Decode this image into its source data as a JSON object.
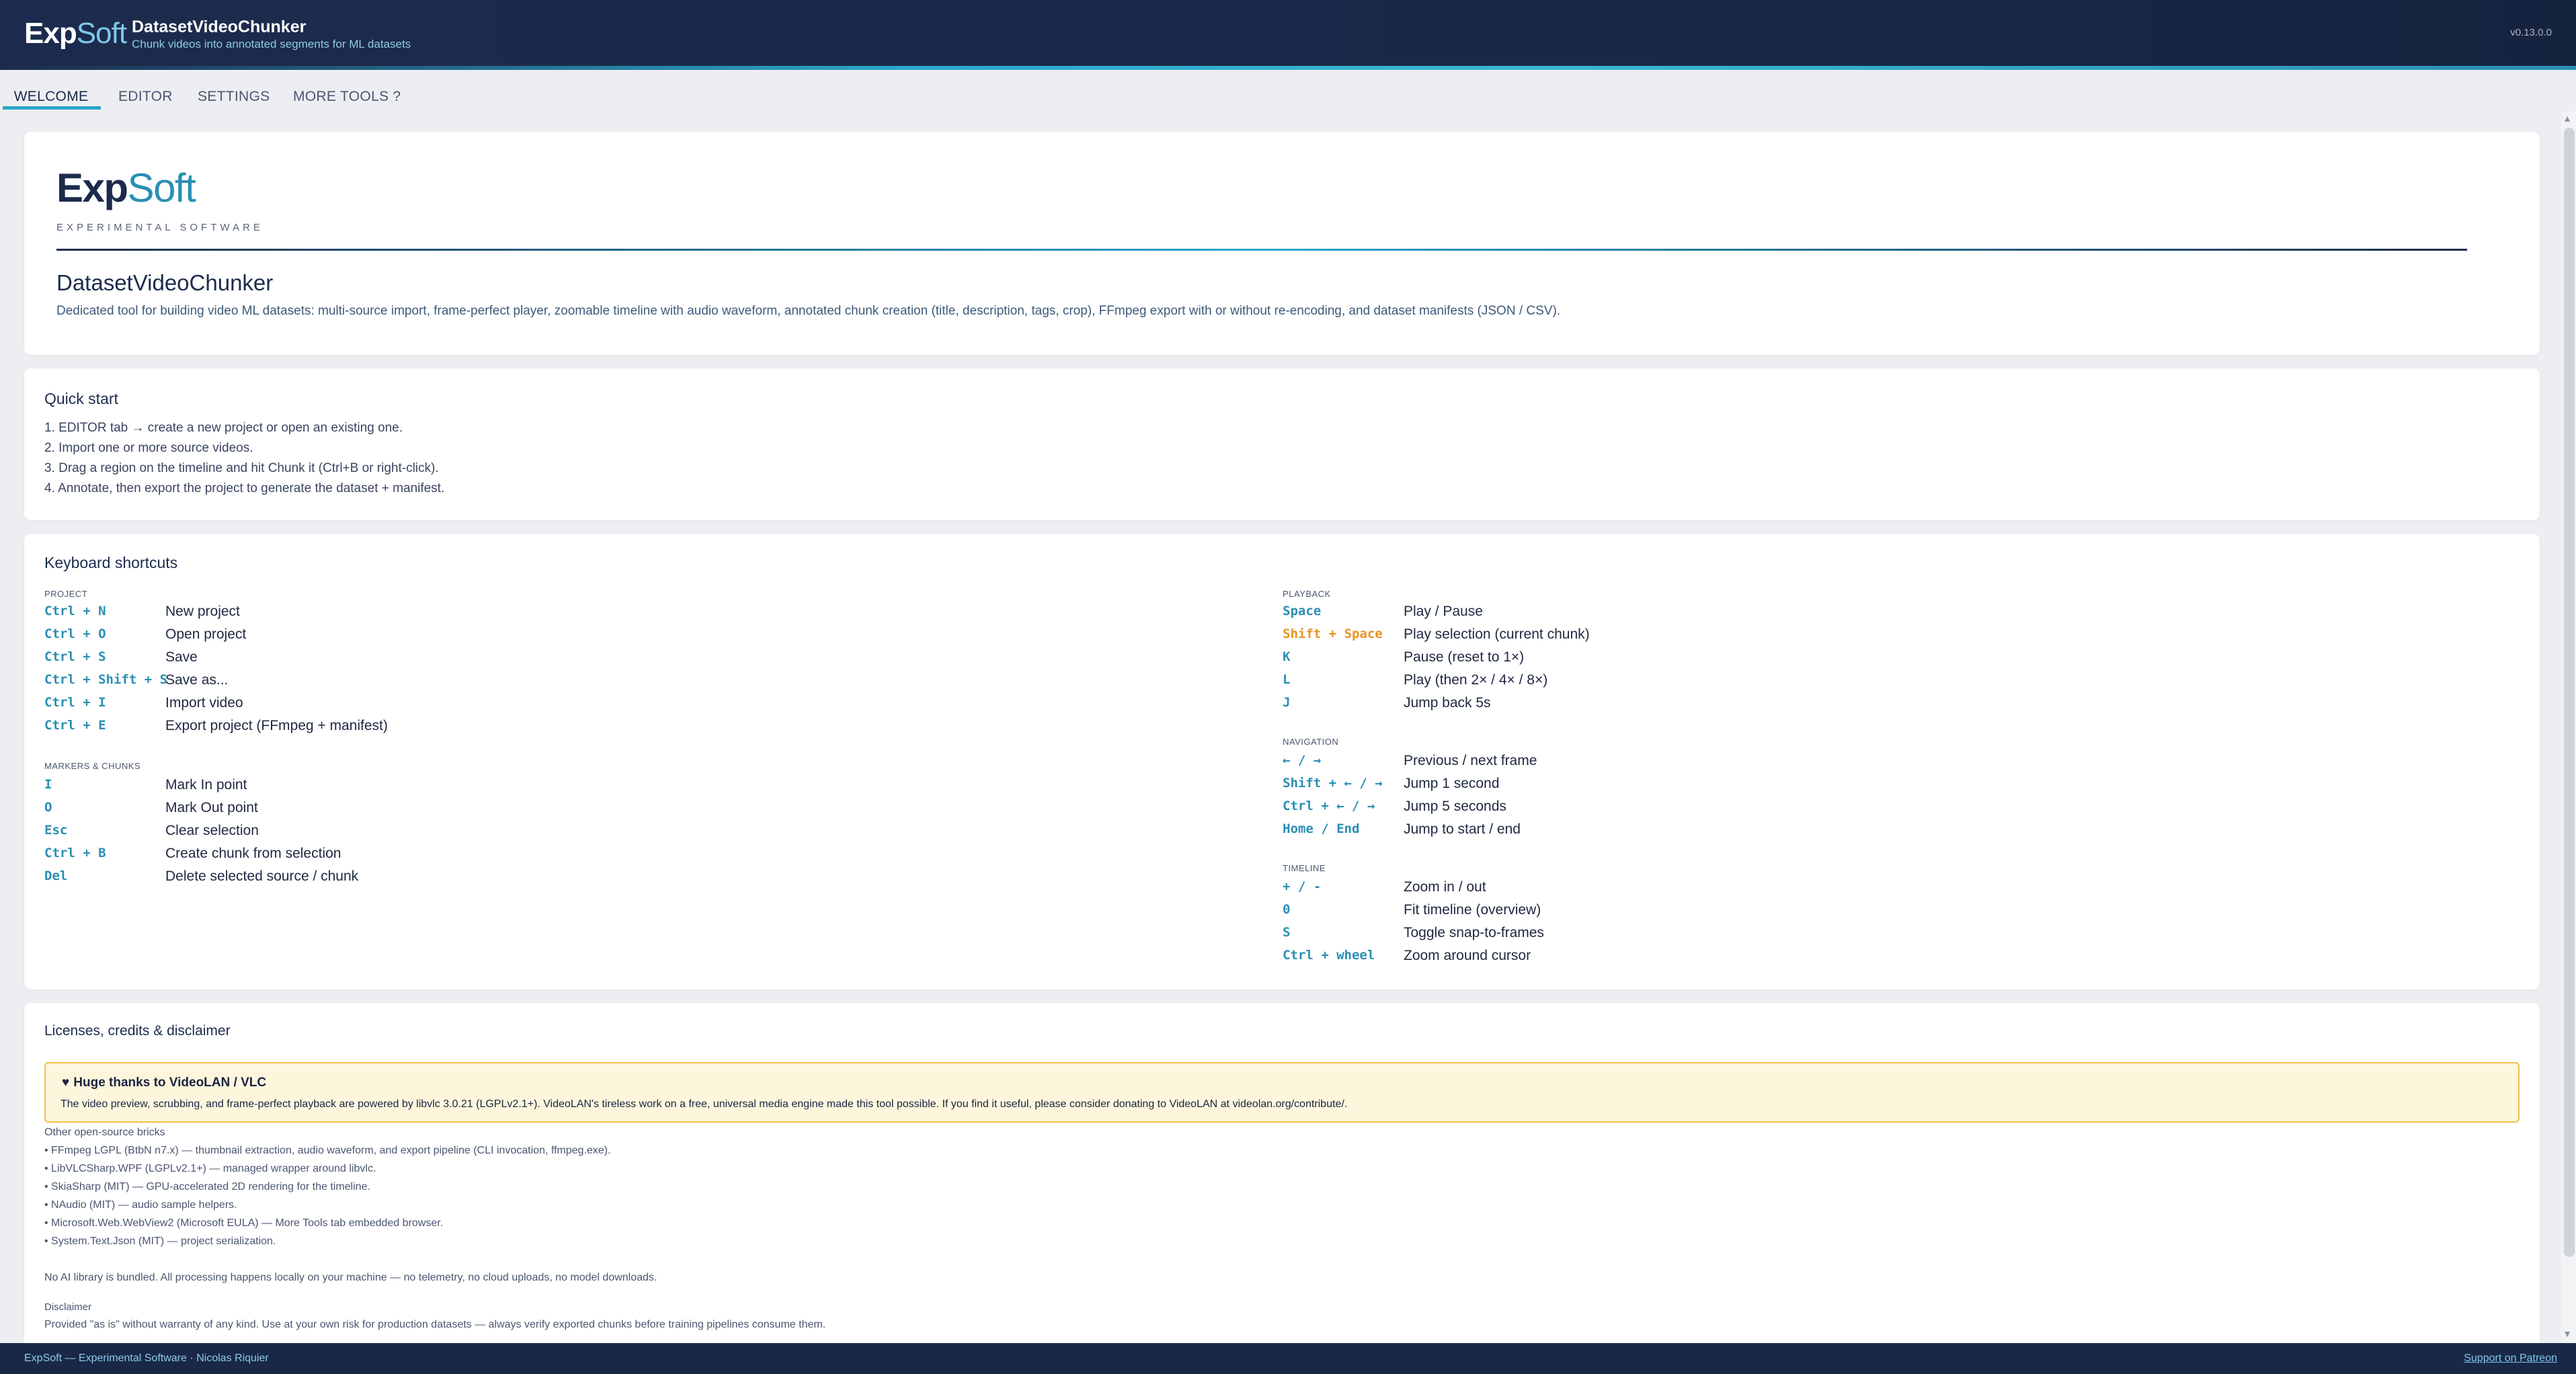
{
  "header": {
    "logo_exp": "Exp",
    "logo_soft": "Soft",
    "app_title": "DatasetVideoChunker",
    "app_subtitle": "Chunk videos into annotated segments for ML datasets",
    "version": "v0.13.0.0"
  },
  "tabs": [
    {
      "label": "WELCOME",
      "active": true
    },
    {
      "label": "EDITOR"
    },
    {
      "label": "SETTINGS"
    },
    {
      "label": "MORE TOOLS ?"
    }
  ],
  "intro": {
    "brand_exp": "Exp",
    "brand_soft": "Soft",
    "tagline": "EXPERIMENTAL SOFTWARE",
    "title": "DatasetVideoChunker",
    "description": "Dedicated tool for building video ML datasets: multi-source import, frame-perfect player, zoomable timeline with audio waveform, annotated chunk creation (title, description, tags, crop), FFmpeg export with or without re-encoding, and dataset manifests (JSON / CSV)."
  },
  "quick_start": {
    "title": "Quick start",
    "steps": [
      "1. EDITOR tab → create a new project or open an existing one.",
      "2. Import one or more source videos.",
      "3. Drag a region on the timeline and hit Chunk it (Ctrl+B or right-click).",
      "4. Annotate, then export the project to generate the dataset + manifest."
    ]
  },
  "shortcuts": {
    "title": "Keyboard shortcuts",
    "project": {
      "label": "PROJECT",
      "items": [
        {
          "key": "Ctrl + N",
          "desc": "New project"
        },
        {
          "key": "Ctrl + O",
          "desc": "Open project"
        },
        {
          "key": "Ctrl + S",
          "desc": "Save"
        },
        {
          "key": "Ctrl + Shift + S",
          "desc": "Save as..."
        },
        {
          "key": "Ctrl + I",
          "desc": "Import video"
        },
        {
          "key": "Ctrl + E",
          "desc": "Export project (FFmpeg + manifest)"
        }
      ]
    },
    "markers": {
      "label": "MARKERS & CHUNKS",
      "items": [
        {
          "key": "I",
          "desc": "Mark In point"
        },
        {
          "key": "O",
          "desc": "Mark Out point"
        },
        {
          "key": "Esc",
          "desc": "Clear selection"
        },
        {
          "key": "Ctrl + B",
          "desc": "Create chunk from selection"
        },
        {
          "key": "Del",
          "desc": "Delete selected source / chunk"
        }
      ]
    },
    "playback": {
      "label": "PLAYBACK",
      "items": [
        {
          "key": "Space",
          "desc": "Play / Pause"
        },
        {
          "key": "Shift + Space",
          "desc": "Play selection (current chunk)"
        },
        {
          "key": "K",
          "desc": "Pause (reset to 1×)"
        },
        {
          "key": "L",
          "desc": "Play (then 2× / 4× / 8×)"
        },
        {
          "key": "J",
          "desc": "Jump back 5s"
        }
      ]
    },
    "navigation": {
      "label": "NAVIGATION",
      "items": [
        {
          "key": "← / →",
          "desc": "Previous / next frame"
        },
        {
          "key": "Shift + ← / →",
          "desc": "Jump 1 second"
        },
        {
          "key": "Ctrl + ← / →",
          "desc": "Jump 5 seconds"
        },
        {
          "key": "Home / End",
          "desc": "Jump to start / end"
        }
      ]
    },
    "timeline": {
      "label": "TIMELINE",
      "items": [
        {
          "key": "+ / -",
          "desc": "Zoom in / out"
        },
        {
          "key": "0",
          "desc": "Fit timeline (overview)"
        },
        {
          "key": "S",
          "desc": "Toggle snap-to-frames"
        },
        {
          "key": "Ctrl + wheel",
          "desc": "Zoom around cursor"
        }
      ]
    }
  },
  "licenses": {
    "title": "Licenses, credits & disclaimer",
    "thanks_title": "Huge thanks to VideoLAN / VLC",
    "thanks_text": "The video preview, scrubbing, and frame-perfect playback are powered by libvlc 3.0.21 (LGPLv2.1+). VideoLAN's tireless work on a free, universal media engine made this tool possible. If you find it useful, please consider donating to VideoLAN at videolan.org/contribute/.",
    "bricks_label": "Other open-source bricks",
    "bricks": [
      "• FFmpeg LGPL (BtbN n7.x) — thumbnail extraction, audio waveform, and export pipeline (CLI invocation, ffmpeg.exe).",
      "• LibVLCSharp.WPF (LGPLv2.1+) — managed wrapper around libvlc.",
      "• SkiaSharp (MIT) — GPU-accelerated 2D rendering for the timeline.",
      "• NAudio (MIT) — audio sample helpers.",
      "• Microsoft.Web.WebView2 (Microsoft EULA) — More Tools tab embedded browser.",
      "• System.Text.Json (MIT) — project serialization."
    ],
    "no_ai": "No AI library is bundled. All processing happens locally on your machine — no telemetry, no cloud uploads, no model downloads.",
    "disclaimer_label": "Disclaimer",
    "disclaimer_text": "Provided \"as is\" without warranty of any kind. Use at your own risk for production datasets — always verify exported chunks before training pipelines consume them."
  },
  "footer": {
    "left": "ExpSoft — Experimental Software · Nicolas Riquier",
    "right": "Support on Patreon"
  },
  "colors": {
    "header_bg": "#1c2b4d",
    "accent": "#2aa7c9",
    "shortcut_key": "#2a8fb3",
    "shortcut_key_highlight": "#e89420",
    "thanks_bg": "#fdf6dd",
    "thanks_border": "#f0c048"
  }
}
